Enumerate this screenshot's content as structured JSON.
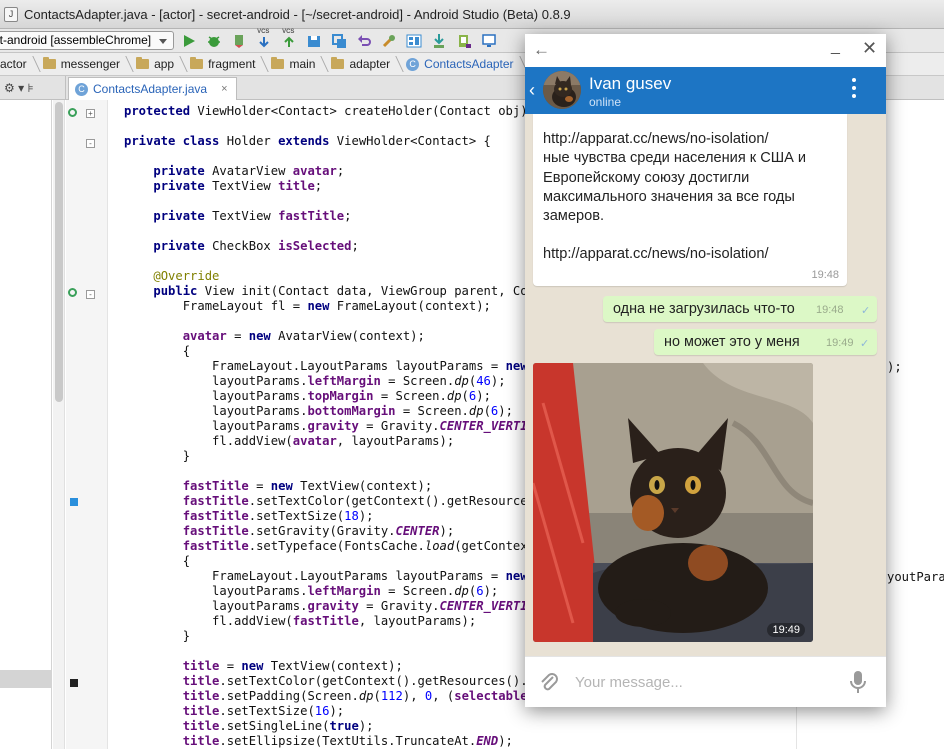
{
  "window_title": "ContactsAdapter.java - [actor] - secret-android - [~/secret-android] - Android Studio (Beta) 0.8.9",
  "file_icon": "J",
  "toolbar": {
    "run_config": "et-android [assembleChrome]",
    "icons": [
      "run-icon",
      "debug-icon",
      "attach-debugger-icon",
      "vcs-update-icon",
      "vcs-commit-icon",
      "sdk-manager-icon",
      "avd-manager-icon",
      "undo-icon",
      "structure-icon",
      "layout-icon",
      "sync-icon",
      "device-icon",
      "monitor-icon"
    ],
    "vcs_label": "VCS"
  },
  "breadcrumbs": [
    "actor",
    "messenger",
    "app",
    "fragment",
    "main",
    "adapter",
    "ContactsAdapter"
  ],
  "tool_panel_label": "⚙ ▾ ⊧",
  "editor_tab": {
    "label": "ContactsAdapter.java",
    "close": "×"
  },
  "code": {
    "right_fragments": [
      ");",
      "youtParam"
    ]
  },
  "telegram": {
    "back": "←",
    "minimize": "_",
    "close": "✕",
    "header_back": "‹",
    "contact_name": "Ivan gusev",
    "status": "online",
    "incoming": {
      "text_line1": "http://apparat.cc/news/no-isolation/",
      "text_line2": "ные чувства среди населения к США и Европейскому союзу достигли максимального значения за все годы замеров.",
      "text_line3": "http://apparat.cc/news/no-isolation/",
      "time": "19:48"
    },
    "outgoing": [
      {
        "text": "одна не загрузилась что-то",
        "time": "19:48"
      },
      {
        "text": "но может это у меня",
        "time": "19:49"
      }
    ],
    "photo": {
      "time": "19:49"
    },
    "input_placeholder": "Your message...",
    "colors": {
      "header": "#1d75c4",
      "chat_bg": "#e8e1d4",
      "outgoing_bubble": "#dcf8c6"
    }
  }
}
